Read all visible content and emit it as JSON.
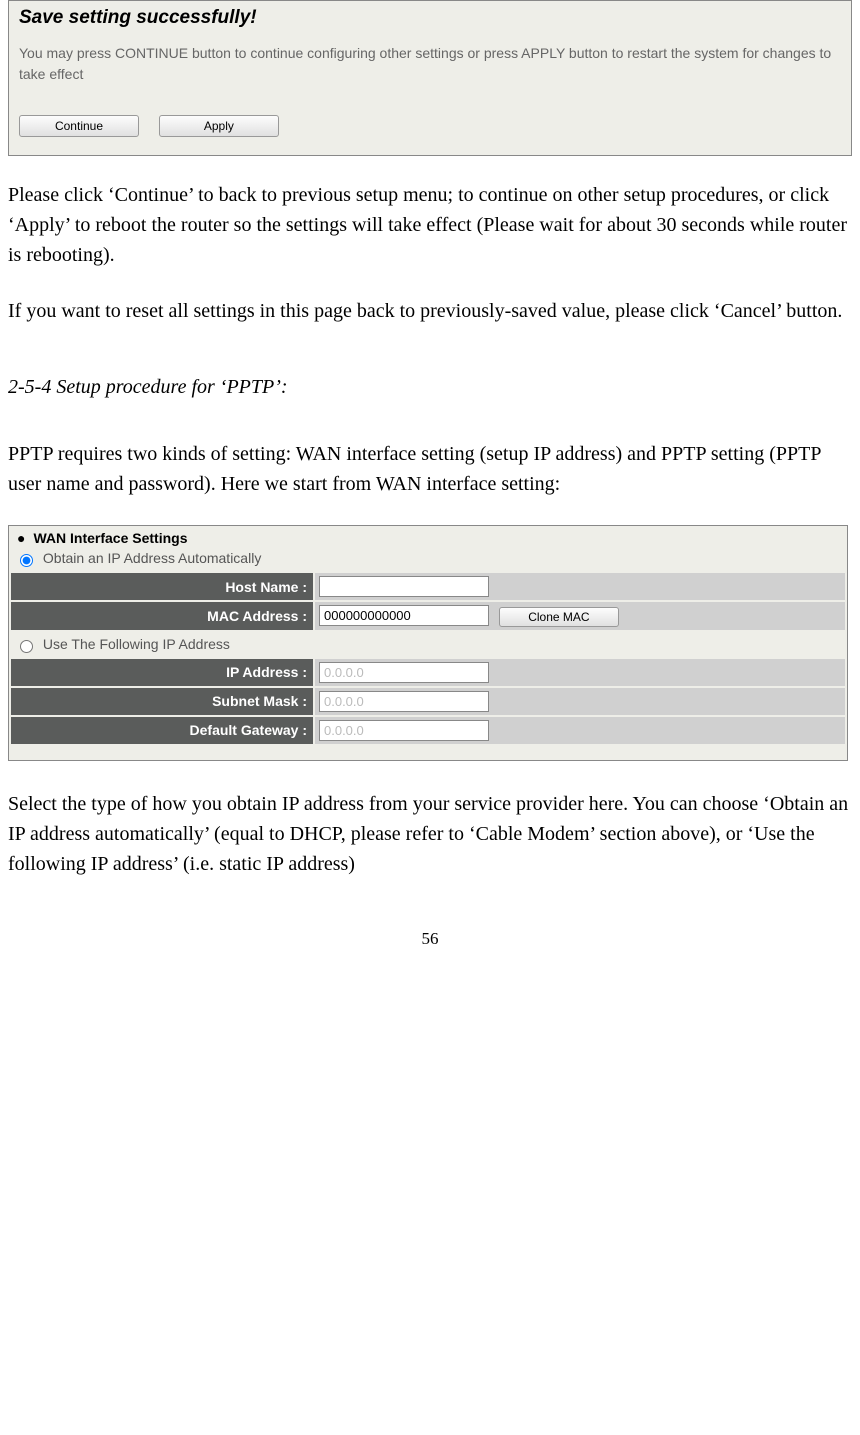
{
  "dialog": {
    "title": "Save setting successfully!",
    "text": "You may press CONTINUE button to continue configuring other settings or press APPLY button to restart the system for changes to take effect",
    "continue_label": "Continue",
    "apply_label": "Apply"
  },
  "paragraphs": {
    "p1": "Please click ‘Continue’ to back to previous setup menu; to continue on other setup procedures, or click ‘Apply’ to reboot the router so the settings will take effect (Please wait for about 30 seconds while router is rebooting).",
    "p2": "If you want to reset all settings in this page back to previously-saved value, please click ‘Cancel’ button.",
    "heading": "2-5-4 Setup procedure for ‘PPTP’:",
    "p3": "PPTP requires two kinds of setting: WAN interface setting (setup IP address) and PPTP setting (PPTP user name and password). Here we start from WAN interface setting:",
    "p4": "Select the type of how you obtain IP address from your service provider here. You can choose ‘Obtain an IP address automatically’ (equal to DHCP, please refer to ‘Cable Modem’ section above), or ‘Use the following IP address’ (i.e. static IP address)"
  },
  "wan": {
    "title": "WAN Interface Settings",
    "radio_auto": "Obtain an IP Address Automatically",
    "radio_static": "Use The Following IP Address",
    "host_name_label": "Host Name :",
    "host_name_value": "",
    "mac_label": "MAC Address :",
    "mac_value": "000000000000",
    "clone_label": "Clone MAC",
    "ip_label": "IP Address :",
    "ip_value": "0.0.0.0",
    "subnet_label": "Subnet Mask :",
    "subnet_value": "0.0.0.0",
    "gateway_label": "Default Gateway :",
    "gateway_value": "0.0.0.0"
  },
  "page_number": "56"
}
